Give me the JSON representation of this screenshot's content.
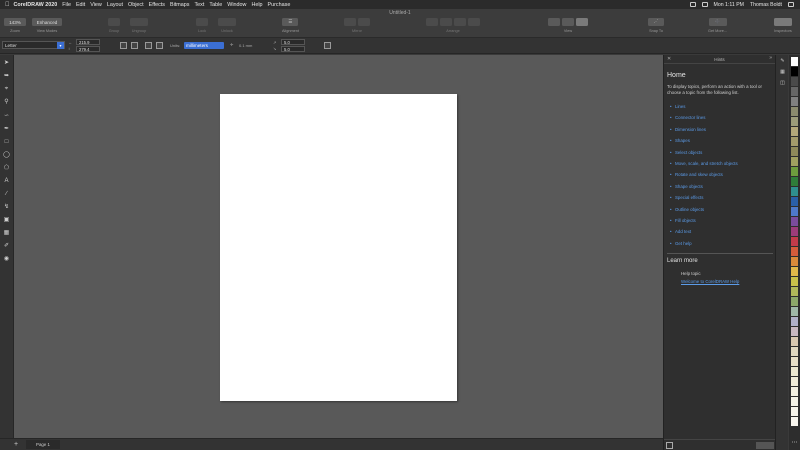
{
  "menubar": {
    "app": "CorelDRAW 2020",
    "items": [
      "File",
      "Edit",
      "View",
      "Layout",
      "Object",
      "Effects",
      "Bitmaps",
      "Text",
      "Table",
      "Window",
      "Help",
      "Purchase"
    ],
    "time": "Mon 1:11 PM",
    "user": "Thomas Boldt"
  },
  "toolbar": {
    "document_title": "Untitled-1",
    "zoom": {
      "value": "143%",
      "label": "Zoom"
    },
    "view_modes": {
      "value": "Enhanced",
      "label": "View Modes"
    },
    "group_label": "Group",
    "ungroup_label": "Ungroup",
    "lock_label": "Lock",
    "unlock_label": "Unlock",
    "alignment_label": "Alignment",
    "mirror_label": "Mirror",
    "arrange_label": "Arrange",
    "view_label": "View",
    "snap_to_label": "Snap To",
    "get_more_label": "Get More...",
    "inspectors_label": "Inspectors"
  },
  "propbar": {
    "page_size": "Letter",
    "width": "215.9",
    "height": "279.4",
    "units_label": "Units:",
    "units_value": "millimeters",
    "nudge": "0.1 mm",
    "dup_x": "5.0",
    "dup_y": "5.0"
  },
  "pagebar": {
    "page_tab": "Page 1"
  },
  "hints": {
    "title": "Hints",
    "home": "Home",
    "intro": "To display topics, perform an action with a tool or choose a topic from the following list.",
    "topics": [
      "Lines",
      "Connector lines",
      "Dimension lines",
      "Shapes",
      "Select objects",
      "Move, scale, and stretch objects",
      "Rotate and skew objects",
      "Shape objects",
      "Special effects",
      "Outline objects",
      "Fill objects",
      "Add text",
      "Get help"
    ],
    "learn_more": "Learn more",
    "help_topic": "Help topic",
    "help_link": "Welcome to CorelDRAW Help"
  },
  "colors": {
    "accent": "#3b6fd4",
    "link": "#5b9be8",
    "palette": [
      "#ffffff",
      "#000000",
      "#4a4a4a",
      "#666666",
      "#808080",
      "#8b8b6e",
      "#9c9c7a",
      "#b3a87a",
      "#a39b6b",
      "#8f8a5a",
      "#a0a060",
      "#6d9c3e",
      "#2f7d3a",
      "#2f8f8f",
      "#2a5fa8",
      "#4e79c9",
      "#7a4c9c",
      "#9c3c7a",
      "#c23b4a",
      "#d45c3b",
      "#d98a3a",
      "#e0b84a",
      "#c8c04a",
      "#b0b85a",
      "#8ca86a",
      "#9fb8a8",
      "#b0b0c8",
      "#c8b8c0",
      "#d8c8b0",
      "#e0d8c0",
      "#e8e0c8",
      "#ece8d0",
      "#f0ecd8",
      "#f2efe0",
      "#f4f2e6",
      "#f6f4ea",
      "#f8f6ee"
    ]
  }
}
